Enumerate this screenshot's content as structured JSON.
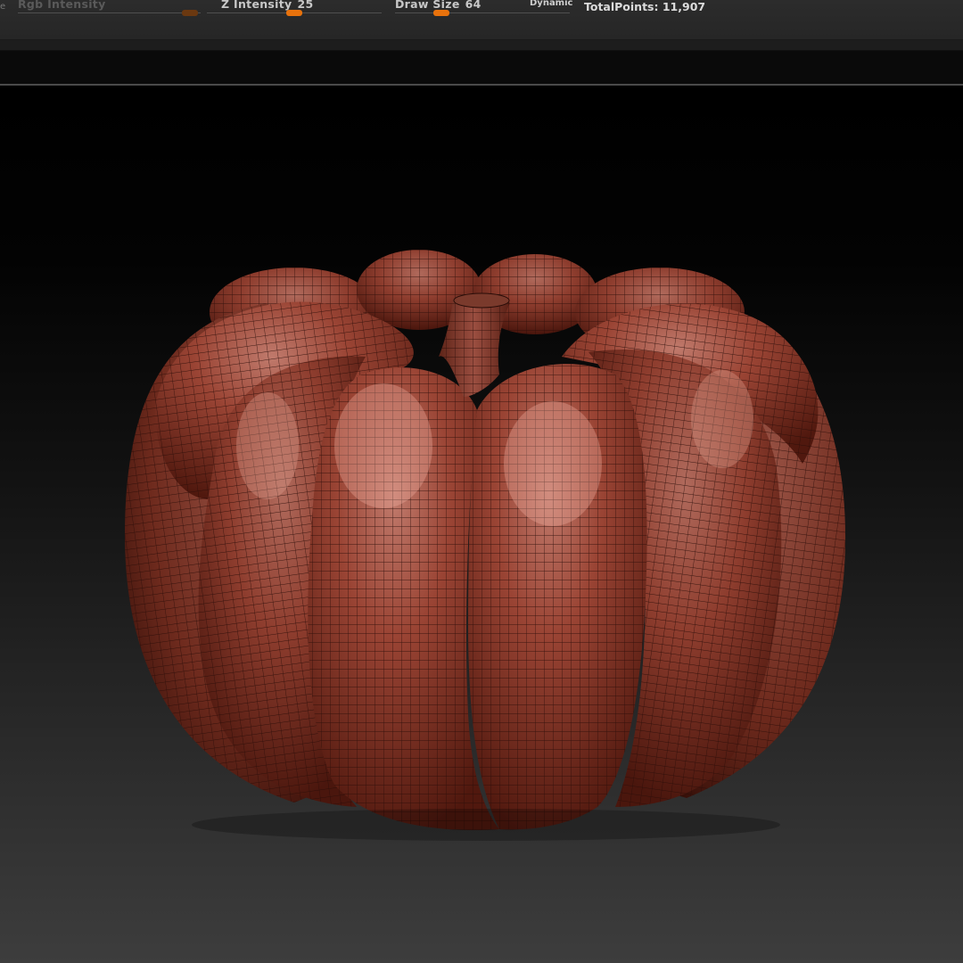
{
  "toolbar": {
    "edge_glyph": "e",
    "rgb_intensity": {
      "label": "Rgb Intensity",
      "value": ""
    },
    "z_intensity": {
      "label": "Z Intensity",
      "value": "25"
    },
    "draw_size": {
      "label": "Draw Size",
      "value": "64"
    },
    "dynamic_label": "Dynamic",
    "total_points": {
      "label": "TotalPoints:",
      "value": "11,907"
    }
  },
  "colors": {
    "accent": "#e8720c",
    "mesh_base": "#8a3a2c",
    "wire": "#2a0d08"
  },
  "icons": [
    "slider-handle",
    "pumpkin-mesh"
  ]
}
